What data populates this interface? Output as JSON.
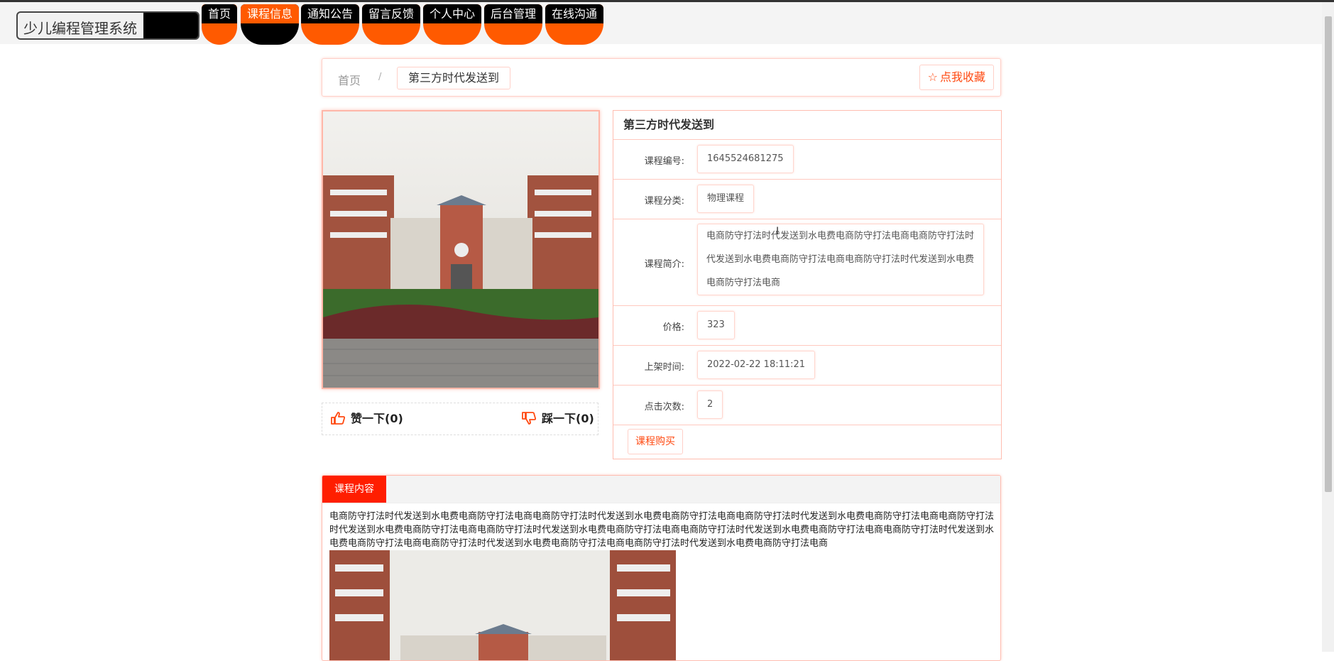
{
  "header": {
    "brand": "少儿编程管理系统",
    "nav": [
      {
        "label": "首页",
        "active": false
      },
      {
        "label": "课程信息",
        "active": true
      },
      {
        "label": "通知公告",
        "active": false
      },
      {
        "label": "留言反馈",
        "active": false
      },
      {
        "label": "个人中心",
        "active": false
      },
      {
        "label": "后台管理",
        "active": false
      },
      {
        "label": "在线沟通",
        "active": false
      }
    ]
  },
  "breadcrumb": {
    "home": "首页",
    "separator": "/",
    "current": "第三方时代发送到",
    "favorite_label": "点我收藏"
  },
  "votes": {
    "like_label": "赞一下(0)",
    "dislike_label": "踩一下(0)"
  },
  "detail": {
    "title": "第三方时代发送到",
    "fields": [
      {
        "label": "课程编号:",
        "value": "1645524681275"
      },
      {
        "label": "课程分类:",
        "value": "物理课程"
      },
      {
        "label": "课程简介:",
        "value": "电商防守打法时代发送到水电费电商防守打法电商电商防守打法时代发送到水电费电商防守打法电商电商防守打法时代发送到水电费电商防守打法电商"
      },
      {
        "label": "价格:",
        "value": "323"
      },
      {
        "label": "上架时间:",
        "value": "2022-02-22 18:11:21"
      },
      {
        "label": "点击次数:",
        "value": "2"
      }
    ],
    "buy_label": "课程购买"
  },
  "content": {
    "tab_label": "课程内容",
    "text": "电商防守打法时代发送到水电费电商防守打法电商电商防守打法时代发送到水电费电商防守打法电商电商防守打法时代发送到水电费电商防守打法电商电商防守打法时代发送到水电费电商防守打法电商电商防守打法时代发送到水电费电商防守打法电商电商防守打法时代发送到水电费电商防守打法电商电商防守打法时代发送到水电费电商防守打法电商电商防守打法时代发送到水电费电商防守打法电商电商防守打法时代发送到水电费电商防守打法电商"
  },
  "colors": {
    "accent": "#ff5a00",
    "nav_bg": "#000000",
    "tab_active": "#ff1e00",
    "border": "#ffbdb0"
  },
  "icons": {
    "favorite": "star-icon",
    "like": "thumbs-up-icon",
    "dislike": "thumbs-down-icon"
  }
}
